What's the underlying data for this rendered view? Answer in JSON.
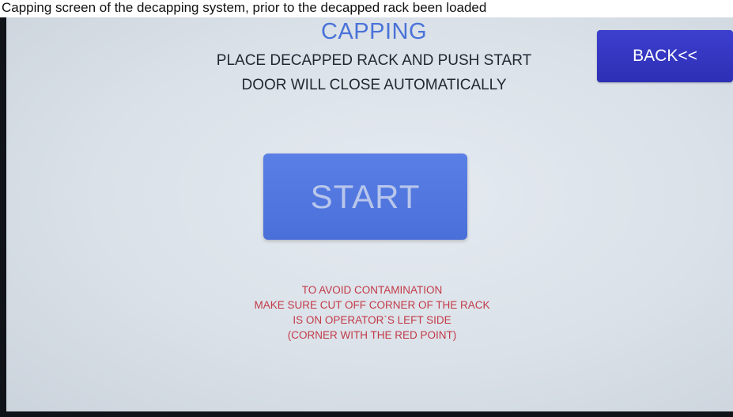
{
  "caption": "Capping screen of the decapping system, prior to the decapped rack been loaded",
  "screen": {
    "title": "CAPPING",
    "instruction_lines": [
      "PLACE DECAPPED RACK AND PUSH START",
      "DOOR WILL CLOSE AUTOMATICALLY"
    ],
    "back_label": "BACK<<",
    "start_label": "START",
    "warning_lines": [
      "TO AVOID CONTAMINATION",
      "MAKE SURE CUT OFF CORNER OF THE RACK",
      "IS ON OPERATOR`S LEFT SIDE",
      "(CORNER WITH THE RED POINT)"
    ]
  },
  "colors": {
    "title": "#4a72d8",
    "back_button": "#3436c4",
    "start_button": "#5278e0",
    "warning_text": "#c23a48",
    "screen_background": "#dde3ea"
  }
}
